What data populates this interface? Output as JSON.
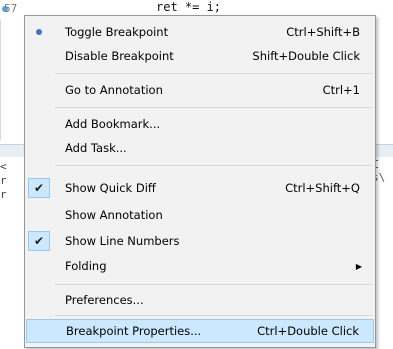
{
  "editor": {
    "line_number": "57",
    "code_fragment": "ret *= i;",
    "left_margin_chars": [
      "<",
      "r",
      "r"
    ],
    "right_edge_chars": [
      "Σ",
      "s\\"
    ]
  },
  "menu": {
    "items": [
      {
        "label": "Toggle Breakpoint",
        "accel": "Ctrl+Shift+B",
        "icon": "breakpoint-dot-icon"
      },
      {
        "label": "Disable Breakpoint",
        "accel": "Shift+Double Click"
      },
      {
        "label": "Go to Annotation",
        "accel": "Ctrl+1"
      },
      {
        "label": "Add Bookmark...",
        "accel": ""
      },
      {
        "label": "Add Task...",
        "accel": ""
      },
      {
        "label": "Show Quick Diff",
        "accel": "Ctrl+Shift+Q",
        "checked": true
      },
      {
        "label": "Show Annotation",
        "accel": ""
      },
      {
        "label": "Show Line Numbers",
        "accel": "",
        "checked": true
      },
      {
        "label": "Folding",
        "accel": "",
        "submenu": true
      },
      {
        "label": "Preferences...",
        "accel": ""
      },
      {
        "label": "Breakpoint Properties...",
        "accel": "Ctrl+Double Click",
        "highlighted": true
      }
    ],
    "colors": {
      "background": "#f2f2f2",
      "highlight": "#cce8ff",
      "highlight_border": "#99c9ef",
      "breakpoint": "#3f74c0"
    }
  }
}
